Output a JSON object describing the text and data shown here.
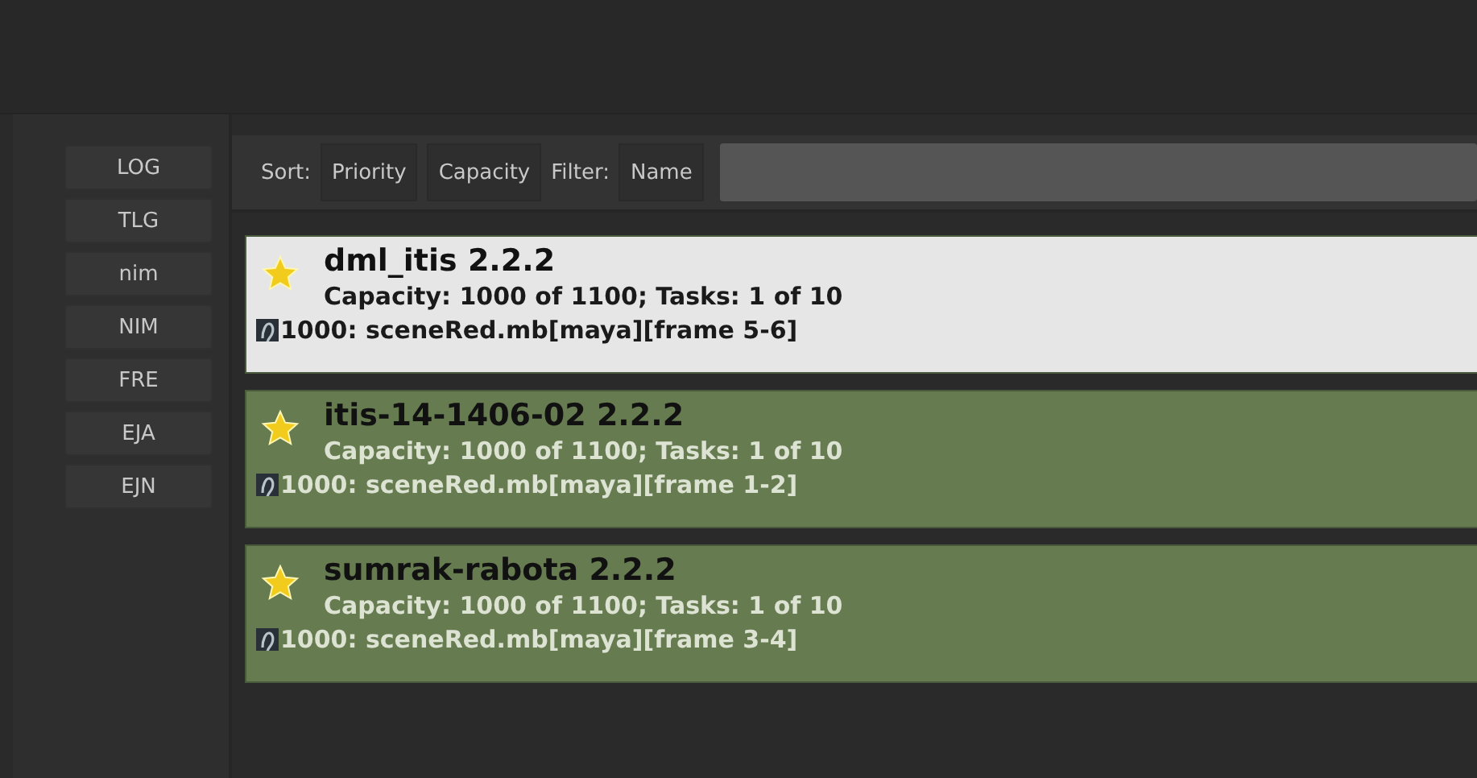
{
  "sidebar": {
    "items": [
      {
        "label": "LOG"
      },
      {
        "label": "TLG"
      },
      {
        "label": "nim"
      },
      {
        "label": "NIM"
      },
      {
        "label": "FRE"
      },
      {
        "label": "EJA"
      },
      {
        "label": "EJN"
      }
    ]
  },
  "toolbar": {
    "sort_label": "Sort:",
    "sort_buttons": [
      "Priority",
      "Capacity"
    ],
    "filter_label": "Filter:",
    "filter_button": "Name"
  },
  "jobs": [
    {
      "title": "dml_itis 2.2.2",
      "capacity": "Capacity: 1000 of 1100; Tasks: 1 of 10",
      "task": "1000: sceneRed.mb[maya][frame 5-6]",
      "selected": true
    },
    {
      "title": "itis-14-1406-02 2.2.2",
      "capacity": "Capacity: 1000 of 1100; Tasks: 1 of 10",
      "task": "1000: sceneRed.mb[maya][frame 1-2]",
      "selected": false
    },
    {
      "title": "sumrak-rabota 2.2.2",
      "capacity": "Capacity: 1000 of 1100; Tasks: 1 of 10",
      "task": "1000: sceneRed.mb[maya][frame 3-4]",
      "selected": false
    }
  ]
}
